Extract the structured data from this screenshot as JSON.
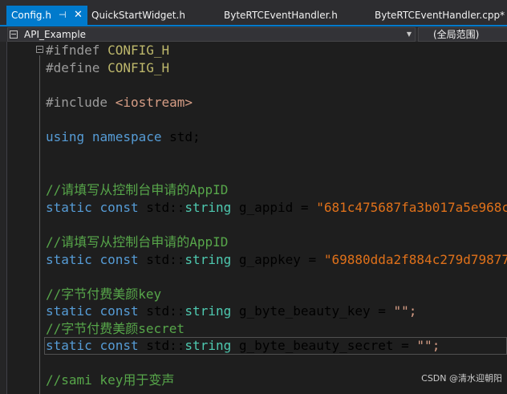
{
  "tabs": [
    {
      "label": "Config.h",
      "active": true
    },
    {
      "label": "QuickStartWidget.h"
    },
    {
      "label": "ByteRTCEventHandler.h"
    },
    {
      "label": "ByteRTCEventHandler.cpp*"
    }
  ],
  "nav": {
    "project": "API_Example",
    "scope": "(全局范围)"
  },
  "code": {
    "l1_dir": "#ifndef",
    "l1_mac": "CONFIG_H",
    "l2_dir": "#define",
    "l2_mac": "CONFIG_H",
    "l3_dir": "#include",
    "l3_inc": "<iostream>",
    "l4_kw1": "using",
    "l4_kw2": "namespace",
    "l4_rest": "std;",
    "c1": "//请填写从控制台申请的AppID",
    "appid_name": "g_appid",
    "appid_val": "\"681c475687fa3b017a5e968c",
    "c2": "//请填写从控制台申请的AppID",
    "appkey_name": "g_appkey",
    "appkey_val": "\"69880dda2f884c279d79877",
    "c3": "//字节付费美颜key",
    "bkey_name": "g_byte_beauty_key",
    "bkey_val": "\"\";",
    "c4": "//字节付费美颜secret",
    "bsec_name": "g_byte_beauty_secret",
    "bsec_val": "\"\";",
    "c5": "//sami key用于变声",
    "kw_static": "static",
    "kw_const": "const",
    "std_ns": "std::",
    "ty_string": "string",
    "eq": " = "
  },
  "watermark": "CSDN @清水迎朝阳",
  "colors": {
    "accent": "#007acc",
    "keyword": "#569cd6",
    "comment": "#57a64a",
    "type": "#4ec9b0",
    "string": "#d69d85",
    "key_string": "#e0711a"
  }
}
